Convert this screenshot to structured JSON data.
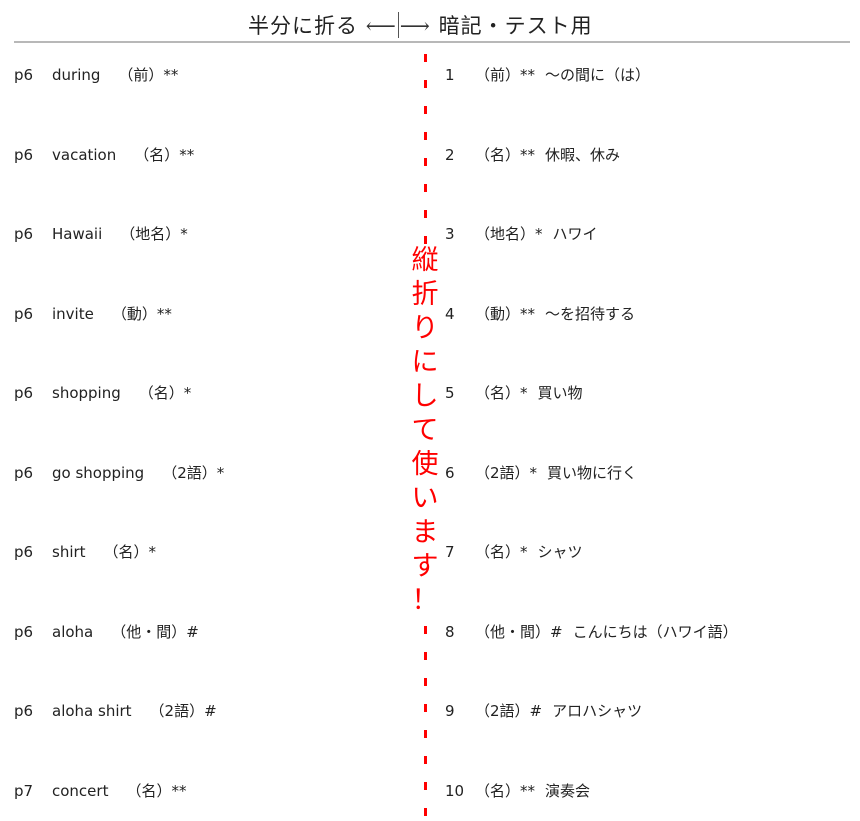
{
  "header": {
    "left_label": "半分に折る",
    "left_arrow": "⟵",
    "right_arrow": "⟶",
    "right_label": "暗記・テスト用"
  },
  "fold_note": [
    "縦",
    "折",
    "り",
    "に",
    "し",
    "て",
    "使",
    "い",
    "ま",
    "す",
    "！"
  ],
  "accent_color": "#ff0000",
  "entries": [
    {
      "page": "p6",
      "word": "during",
      "pos": "（前）**",
      "num": "1",
      "pos_right": "（前）**",
      "meaning": "～の間に（は）"
    },
    {
      "page": "p6",
      "word": "vacation",
      "pos": "（名）**",
      "num": "2",
      "pos_right": "（名）**",
      "meaning": "休暇、休み"
    },
    {
      "page": "p6",
      "word": "Hawaii",
      "pos": "（地名）*",
      "num": "3",
      "pos_right": "（地名）*",
      "meaning": "ハワイ"
    },
    {
      "page": "p6",
      "word": "invite",
      "pos": "（動）**",
      "num": "4",
      "pos_right": "（動）**",
      "meaning": "～を招待する"
    },
    {
      "page": "p6",
      "word": "shopping",
      "pos": "（名）*",
      "num": "5",
      "pos_right": "（名）*",
      "meaning": "買い物"
    },
    {
      "page": "p6",
      "word": "go shopping",
      "pos": "（2語）*",
      "num": "6",
      "pos_right": "（2語）*",
      "meaning": "買い物に行く"
    },
    {
      "page": "p6",
      "word": "shirt",
      "pos": "（名）*",
      "num": "7",
      "pos_right": "（名）*",
      "meaning": "シャツ"
    },
    {
      "page": "p6",
      "word": "aloha",
      "pos": "（他・間）#",
      "num": "8",
      "pos_right": "（他・間）#",
      "meaning": "こんにちは（ハワイ語）"
    },
    {
      "page": "p6",
      "word": "aloha shirt",
      "pos": "（2語）#",
      "num": "9",
      "pos_right": "（2語）#",
      "meaning": "アロハシャツ"
    },
    {
      "page": "p7",
      "word": "concert",
      "pos": "（名）**",
      "num": "10",
      "pos_right": "（名）**",
      "meaning": "演奏会"
    }
  ]
}
